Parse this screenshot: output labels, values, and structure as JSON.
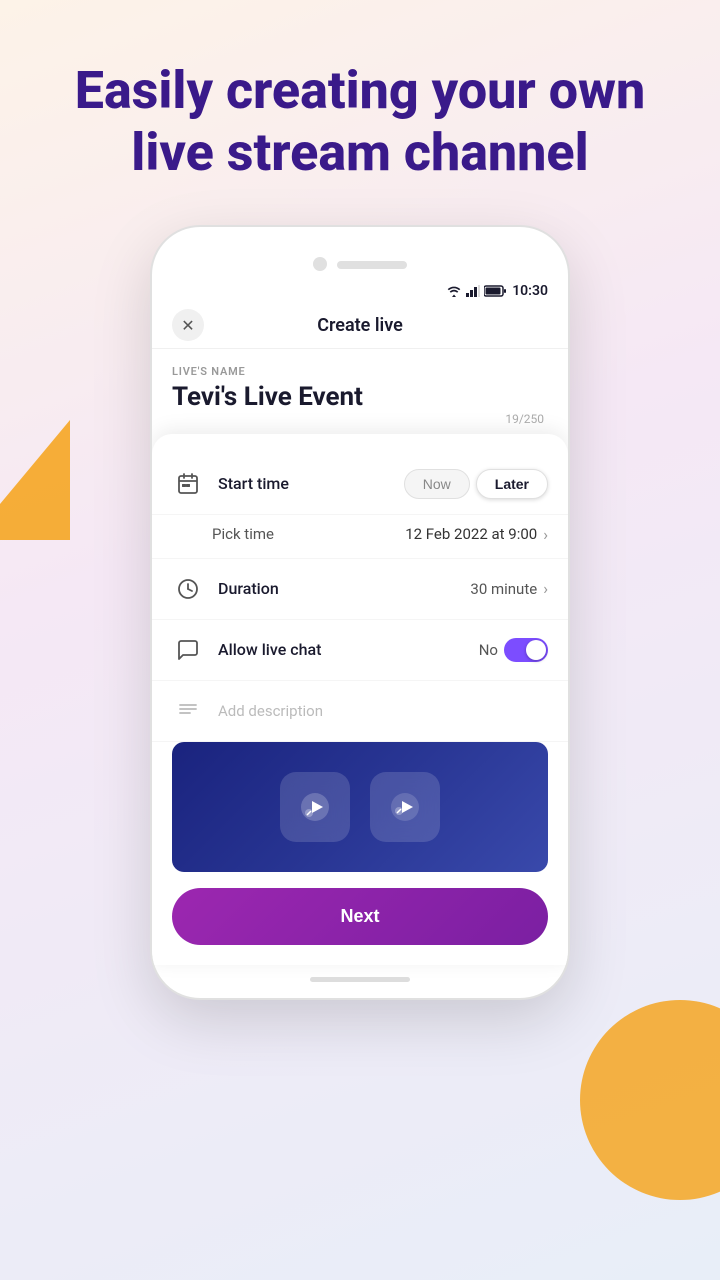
{
  "hero": {
    "title": "Easily creating your own live stream channel"
  },
  "phone": {
    "status_time": "10:30"
  },
  "app": {
    "header_title": "Create live",
    "close_label": "×"
  },
  "form": {
    "live_name_label": "LIVE'S NAME",
    "live_name_value": "Tevi's Live Event",
    "char_count": "19/250",
    "start_time_label": "Start time",
    "start_time_now": "Now",
    "start_time_later": "Later",
    "pick_time_label": "Pick time",
    "pick_time_value": "12 Feb 2022 at 9:00",
    "duration_label": "Duration",
    "duration_value": "30 minute",
    "allow_chat_label": "Allow live chat",
    "allow_chat_value": "No",
    "add_description_placeholder": "Add description"
  },
  "next_button": "Next"
}
